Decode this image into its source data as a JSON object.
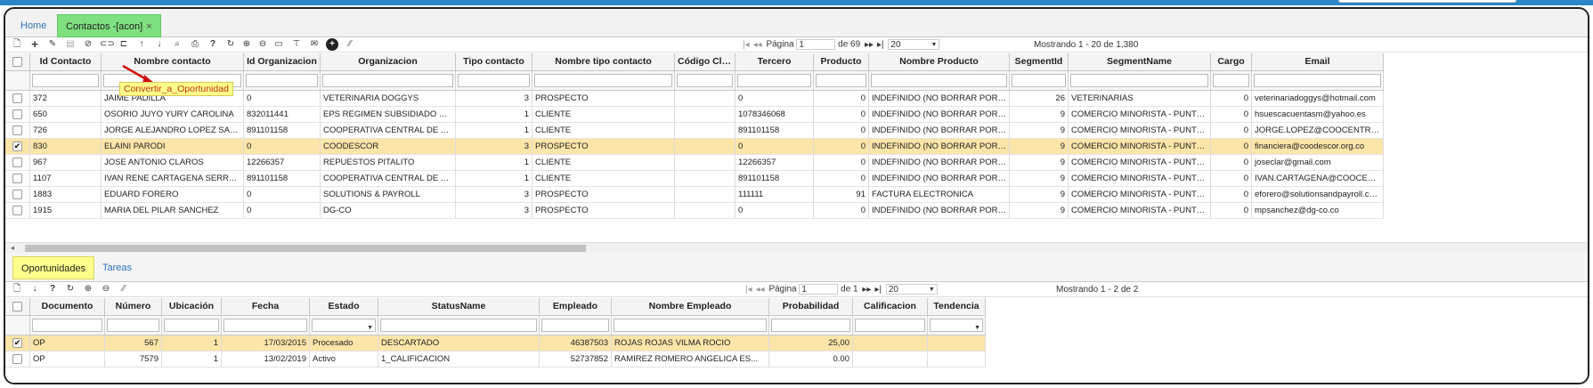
{
  "top_tabs": [
    {
      "label": "Home"
    },
    {
      "label": "Contactos -[acon]",
      "close": "×"
    }
  ],
  "tooltip": "Convertir_a_Oportunidad",
  "main_pager": {
    "page_label": "Página",
    "page_value": "1",
    "of_label": "de 69",
    "page_size": "20",
    "showing": "Mostrando 1 - 20 de 1,380"
  },
  "main_grid": {
    "columns": [
      "Id Contacto",
      "Nombre contacto",
      "Id Organizacion",
      "Organizacion",
      "Tipo contacto",
      "Nombre tipo contacto",
      "Código Cliente",
      "Tercero",
      "Producto",
      "Nombre Producto",
      "SegmentId",
      "SegmentName",
      "Cargo",
      "Email"
    ],
    "rows": [
      {
        "checked": false,
        "cells": [
          "372",
          "JAIME PADILLA",
          "0",
          "VETERINARIA DOGGYS",
          "3",
          "PROSPECTO",
          "",
          "0",
          "0",
          "INDEFINIDO (NO BORRAR POR F...",
          "26",
          "VETERINARIAS",
          "0",
          "veterinariadoggys@hotmail.com"
        ]
      },
      {
        "checked": false,
        "cells": [
          "650",
          "OSORIO JUYO YURY CAROLINA",
          "832011441",
          "EPS REGIMEN SUBSIDIADO CO...",
          "1",
          "CLIENTE",
          "",
          "1078346068",
          "0",
          "INDEFINIDO (NO BORRAR POR F...",
          "9",
          "COMERCIO MINORISTA - PUNTOS...",
          "0",
          "hsuescacuentasm@yahoo.es"
        ]
      },
      {
        "checked": false,
        "cells": [
          "726",
          "JORGE ALEJANDRO LOPEZ SALA...",
          "891101158",
          "COOPERATIVA CENTRAL DE C...",
          "1",
          "CLIENTE",
          "",
          "891101158",
          "0",
          "INDEFINIDO (NO BORRAR POR F...",
          "9",
          "COMERCIO MINORISTA - PUNTOS...",
          "0",
          "JORGE.LOPEZ@COOCENTRAL..."
        ]
      },
      {
        "checked": true,
        "cells": [
          "830",
          "ELAINI PARODI",
          "0",
          "COODESCOR",
          "3",
          "PROSPECTO",
          "",
          "0",
          "0",
          "INDEFINIDO (NO BORRAR POR F...",
          "9",
          "COMERCIO MINORISTA - PUNTOS...",
          "0",
          "financiera@coodescor.org.co"
        ]
      },
      {
        "checked": false,
        "cells": [
          "967",
          "JOSE ANTONIO CLAROS",
          "12266357",
          "REPUESTOS PITALITO",
          "1",
          "CLIENTE",
          "",
          "12266357",
          "0",
          "INDEFINIDO (NO BORRAR POR F...",
          "9",
          "COMERCIO MINORISTA - PUNTOS...",
          "0",
          "joseclar@gmail.com"
        ]
      },
      {
        "checked": false,
        "cells": [
          "1107",
          "IVAN RENE CARTAGENA SERRANO",
          "891101158",
          "COOPERATIVA CENTRAL DE C...",
          "1",
          "CLIENTE",
          "",
          "891101158",
          "0",
          "INDEFINIDO (NO BORRAR POR F...",
          "9",
          "COMERCIO MINORISTA - PUNTOS...",
          "0",
          "IVAN.CARTAGENA@COOCENT..."
        ]
      },
      {
        "checked": false,
        "cells": [
          "1883",
          "EDUARD FORERO",
          "0",
          "SOLUTIONS & PAYROLL",
          "3",
          "PROSPECTO",
          "",
          "111111",
          "91",
          "FACTURA ELECTRONICA",
          "9",
          "COMERCIO MINORISTA - PUNTOS...",
          "0",
          "eforero@solutionsandpayroll.com"
        ]
      },
      {
        "checked": false,
        "cells": [
          "1915",
          "MARIA DEL PILAR SANCHEZ",
          "0",
          "DG-CO",
          "3",
          "PROSPECTO",
          "",
          "0",
          "0",
          "INDEFINIDO (NO BORRAR POR F...",
          "9",
          "COMERCIO MINORISTA - PUNTOS...",
          "0",
          "mpsanchez@dg-co.co"
        ]
      }
    ]
  },
  "bottom_tabs": [
    {
      "label": "Oportunidades"
    },
    {
      "label": "Tareas"
    }
  ],
  "sub_pager": {
    "page_label": "Página",
    "page_value": "1",
    "of_label": "de 1",
    "page_size": "20",
    "showing": "Mostrando 1 - 2 de 2"
  },
  "sub_grid": {
    "columns": [
      "Documento",
      "Número",
      "Ubicación",
      "Fecha",
      "Estado",
      "StatusName",
      "Empleado",
      "Nombre Empleado",
      "Probabilidad",
      "Calificacion",
      "Tendencia"
    ],
    "rows": [
      {
        "checked": true,
        "cells": [
          "OP",
          "567",
          "1",
          "17/03/2015",
          "Procesado",
          "DESCARTADO",
          "46387503",
          "ROJAS ROJAS VILMA ROCIO",
          "25,00",
          "",
          ""
        ]
      },
      {
        "checked": false,
        "cells": [
          "OP",
          "7579",
          "1",
          "13/02/2019",
          "Activo",
          "1_CALIFICACION",
          "52737852",
          "RAMIREZ ROMERO ANGELICA ES...",
          "0.00",
          "",
          ""
        ]
      }
    ]
  },
  "toolbar_icons": [
    "new-document-icon",
    "add-icon",
    "edit-icon",
    "save-icon",
    "cancel-icon",
    "link-icon",
    "unlink-icon",
    "up-arrow-icon",
    "down-arrow-icon",
    "search-icon",
    "print-icon",
    "help-icon",
    "refresh-icon",
    "zoom-in-icon",
    "zoom-out-icon",
    "message-icon",
    "pin-icon",
    "mail-icon",
    "plus-circle-icon",
    "resize-icon"
  ],
  "sub_toolbar_icons": [
    "new-document-icon",
    "down-arrow-icon",
    "help-icon",
    "refresh-icon",
    "zoom-in-icon",
    "zoom-out-icon",
    "resize-icon"
  ],
  "colors": {
    "active_tab": "#7ee07e",
    "highlight_tab": "#ffff8c",
    "selected_row": "#fbe5a8",
    "link": "#2e72b8",
    "top_bar": "#2a86c4"
  }
}
